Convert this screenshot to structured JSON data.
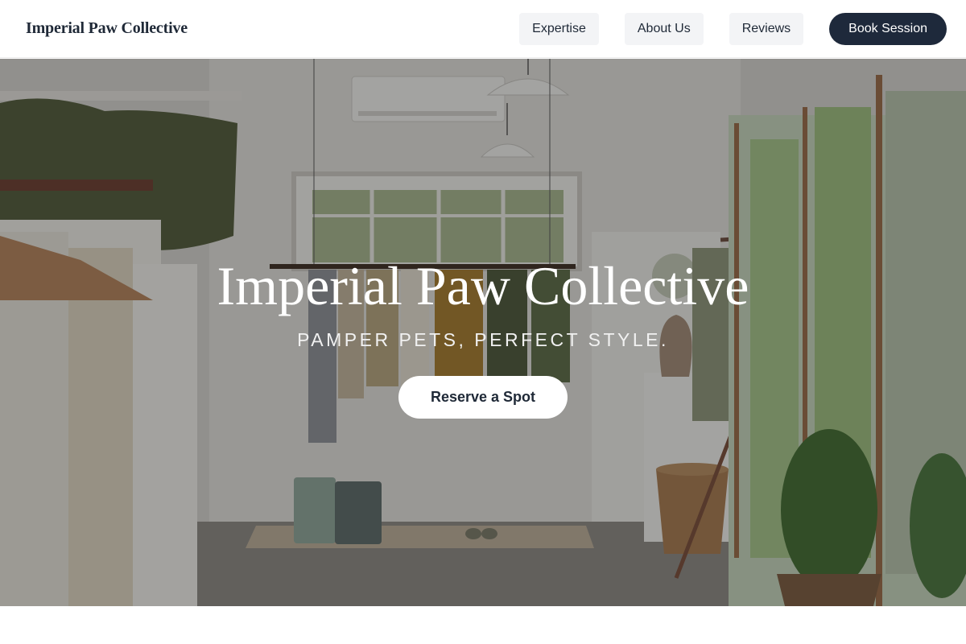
{
  "header": {
    "brand": "Imperial Paw Collective",
    "nav": [
      {
        "label": "Expertise"
      },
      {
        "label": "About Us"
      },
      {
        "label": "Reviews"
      }
    ],
    "cta_label": "Book Session"
  },
  "hero": {
    "title": "Imperial Paw Collective",
    "tagline": "PAMPER PETS, PERFECT STYLE.",
    "cta_label": "Reserve a Spot"
  },
  "colors": {
    "primary": "#1e293b",
    "nav_bg": "#f3f4f6",
    "text": "#1f2937"
  }
}
